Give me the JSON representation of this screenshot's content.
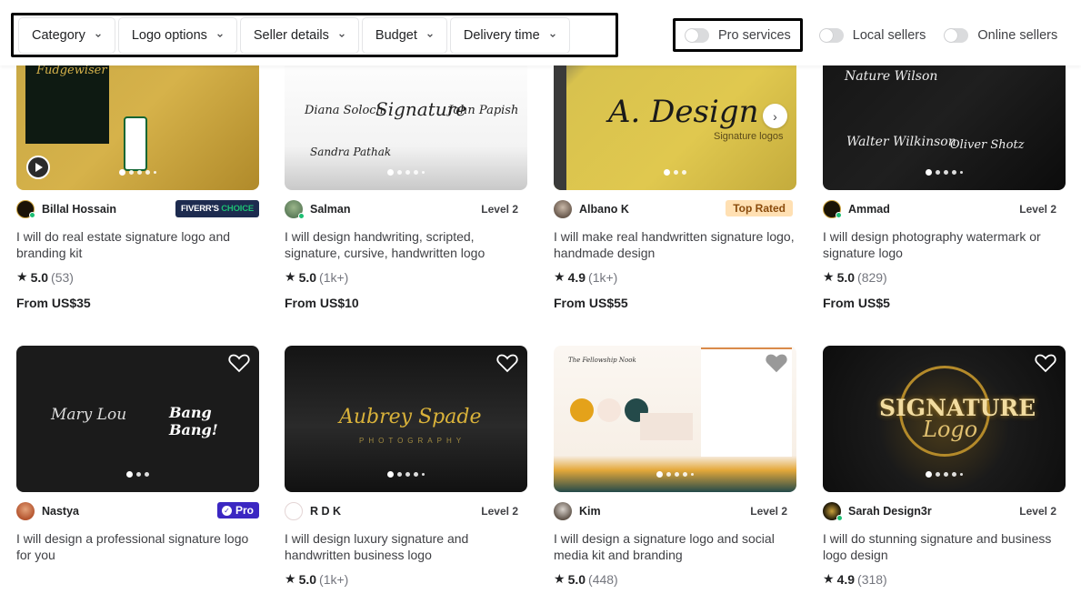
{
  "filters": {
    "dropdowns": [
      {
        "label": "Category"
      },
      {
        "label": "Logo options"
      },
      {
        "label": "Seller details"
      },
      {
        "label": "Budget"
      },
      {
        "label": "Delivery time"
      }
    ],
    "toggles": [
      {
        "label": "Pro services",
        "on": false
      },
      {
        "label": "Local sellers",
        "on": false
      },
      {
        "label": "Online sellers",
        "on": false
      }
    ]
  },
  "gigs": [
    {
      "seller": "Billal Hossain",
      "online": true,
      "badge": {
        "type": "fiverrs-choice",
        "text_a": "FIVERR'S",
        "text_b": "CHOICE"
      },
      "title": "I will do real estate signature logo and branding kit",
      "rating": "5.0",
      "reviews": "(53)",
      "price": "From US$35",
      "thumb_text": "Fudgewiser",
      "slides": 5,
      "active_slide": 1,
      "has_video": true
    },
    {
      "seller": "Salman",
      "online": true,
      "badge": {
        "type": "level",
        "text": "Level 2"
      },
      "title": "I will design handwriting, scripted, signature, cursive, handwritten logo",
      "rating": "5.0",
      "reviews": "(1k+)",
      "price": "From US$10",
      "thumb_text": "Signature",
      "slides": 5,
      "active_slide": 1
    },
    {
      "seller": "Albano K",
      "online": false,
      "badge": {
        "type": "top-rated",
        "text": "Top Rated"
      },
      "title": "I will make real handwritten signature logo, handmade design",
      "rating": "4.9",
      "reviews": "(1k+)",
      "price": "From US$55",
      "thumb_text": "A. Design",
      "thumb_subtext": "Signature logos",
      "slides": 3,
      "active_slide": 1
    },
    {
      "seller": "Ammad",
      "online": true,
      "badge": {
        "type": "level",
        "text": "Level 2"
      },
      "title": "I will design photography watermark or signature logo",
      "rating": "5.0",
      "reviews": "(829)",
      "price": "From US$5",
      "thumb_text": "Nature Wilson",
      "slides": 5,
      "active_slide": 1
    },
    {
      "seller": "Nastya",
      "online": false,
      "badge": {
        "type": "pro",
        "text": "Pro"
      },
      "title": "I will design a professional signature logo for you",
      "rating": null,
      "reviews": null,
      "price": null,
      "thumb_text": "Mary Lou",
      "thumb_subtext": "Bang Bang!",
      "slides": 3,
      "active_slide": 1
    },
    {
      "seller": "R D K",
      "online": false,
      "badge": {
        "type": "level",
        "text": "Level 2"
      },
      "title": "I will design luxury signature and handwritten business logo",
      "rating": "5.0",
      "reviews": "(1k+)",
      "price": null,
      "thumb_text": "Aubrey Spade",
      "thumb_subtext": "PHOTOGRAPHY",
      "slides": 5,
      "active_slide": 1
    },
    {
      "seller": "Kim",
      "online": false,
      "badge": {
        "type": "level",
        "text": "Level 2"
      },
      "title": "I will design a signature logo and social media kit and branding",
      "rating": "5.0",
      "reviews": "(448)",
      "price": null,
      "thumb_text": "The Fellowship Nook",
      "slides": 5,
      "active_slide": 1
    },
    {
      "seller": "Sarah Design3r",
      "online": true,
      "badge": {
        "type": "level",
        "text": "Level 2"
      },
      "title": "I will do stunning signature and business logo design",
      "rating": "4.9",
      "reviews": "(318)",
      "price": null,
      "thumb_text": "SIGNATURE",
      "thumb_subtext": "Logo",
      "slides": 5,
      "active_slide": 1
    }
  ],
  "colors": {
    "online": "#1dbf73",
    "fiverrs_choice_bg": "#1d2b4f",
    "top_rated_bg": "#ffe0b3",
    "pro_bg": "#3b27c2"
  }
}
